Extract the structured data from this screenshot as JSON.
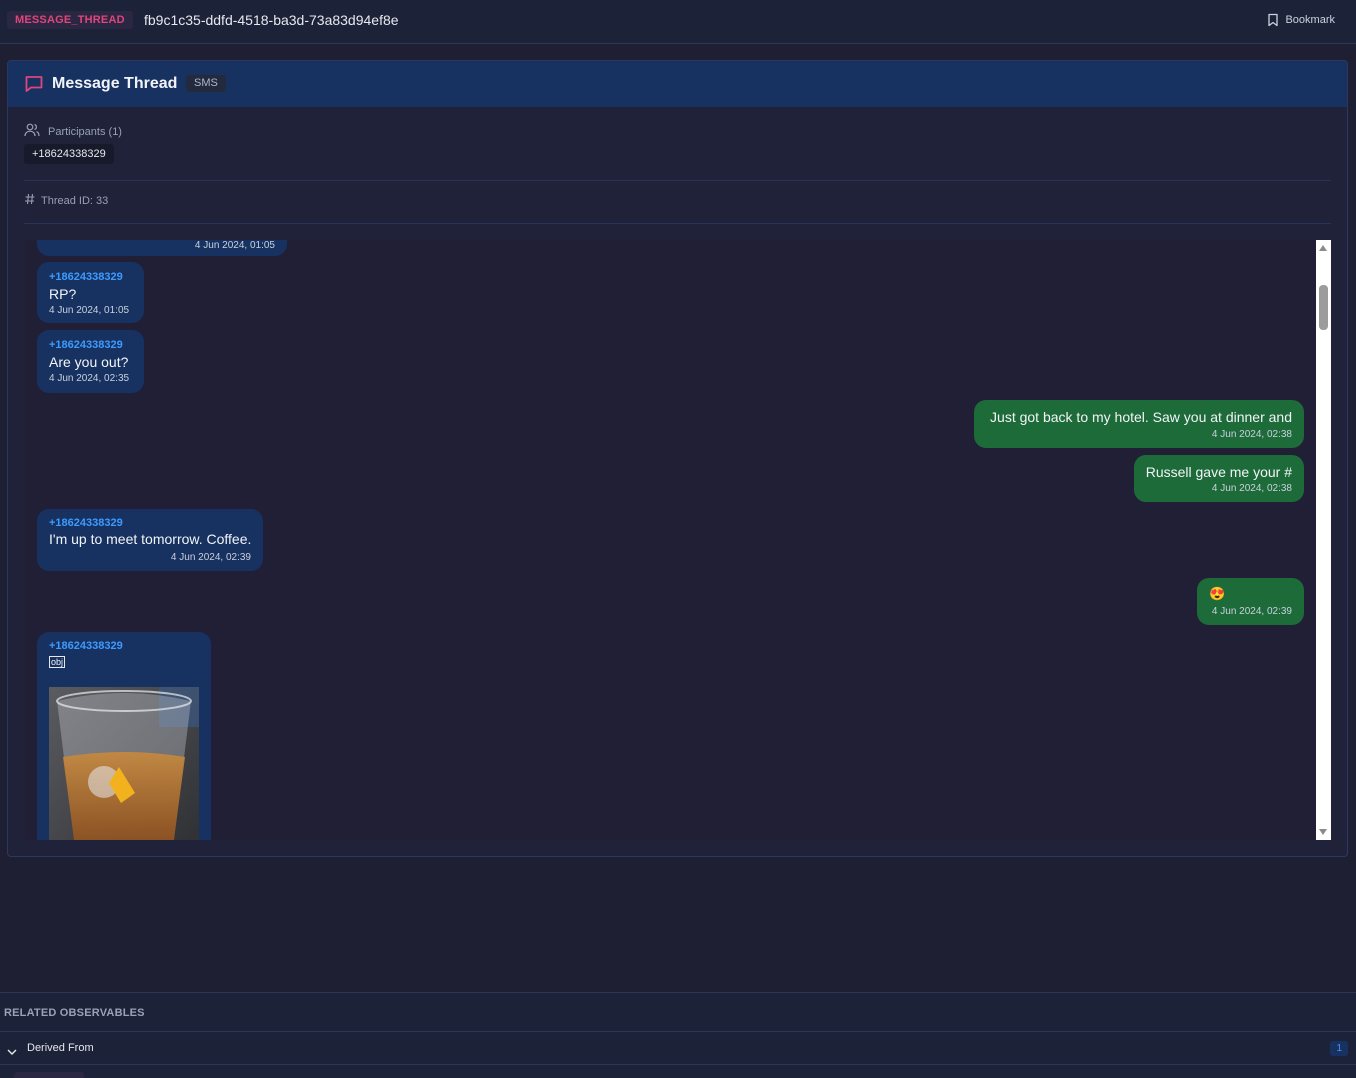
{
  "header": {
    "type_badge": "MESSAGE_THREAD",
    "observable_id": "fb9c1c35-ddfd-4518-ba3d-73a83d94ef8e",
    "bookmark_label": "Bookmark"
  },
  "thread": {
    "title": "Message Thread",
    "channel_badge": "SMS",
    "participants_label": "Participants (1)",
    "participants": [
      "+18624338329"
    ],
    "thread_id_label": "Thread ID: 33"
  },
  "messages": [
    {
      "direction": "in",
      "sender": "",
      "text": "",
      "timestamp": "4 Jun 2024, 01:05"
    },
    {
      "direction": "in",
      "sender": "+18624338329",
      "text": "RP?",
      "timestamp": "4 Jun 2024, 01:05"
    },
    {
      "direction": "in",
      "sender": "+18624338329",
      "text": "Are you out?",
      "timestamp": "4 Jun 2024, 02:35"
    },
    {
      "direction": "out",
      "sender": "",
      "text": "Just got back to my hotel. Saw you at dinner and",
      "timestamp": "4 Jun 2024, 02:38"
    },
    {
      "direction": "out",
      "sender": "",
      "text": "Russell gave me your #",
      "timestamp": "4 Jun 2024, 02:38"
    },
    {
      "direction": "in",
      "sender": "+18624338329",
      "text": "I'm up to meet tomorrow. Coffee.",
      "timestamp": "4 Jun 2024, 02:39"
    },
    {
      "direction": "out",
      "sender": "",
      "text": "😍",
      "timestamp": "4 Jun 2024, 02:39"
    },
    {
      "direction": "in",
      "sender": "+18624338329",
      "text": "obj",
      "timestamp": ""
    }
  ],
  "related": {
    "title": "RELATED OBSERVABLES",
    "group_label": "Derived From",
    "group_count": "1"
  },
  "colors": {
    "accent": "#e0457b",
    "incoming_bubble": "#173261",
    "outgoing_bubble": "#1e6b3a",
    "sender_link": "#3d9bff"
  },
  "icons": {
    "bookmark": "bookmark-icon",
    "thread": "chat-bubble-icon",
    "participants": "users-icon",
    "thread_id": "hash-icon",
    "group_toggle": "chevron-down-icon"
  }
}
